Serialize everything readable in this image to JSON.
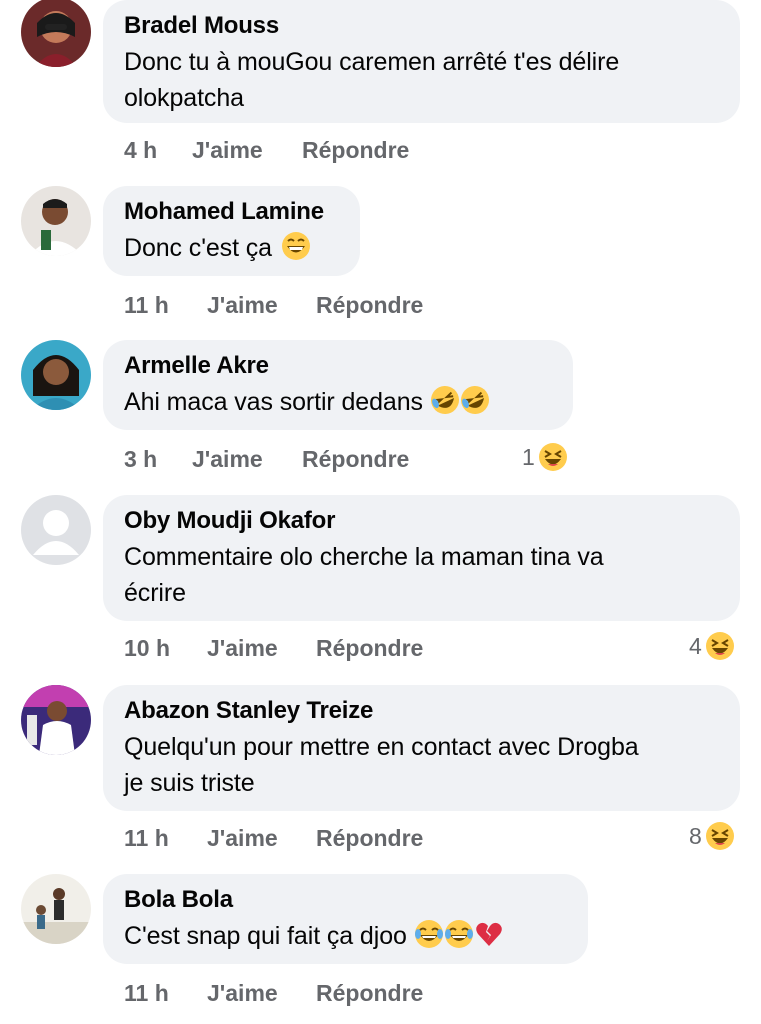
{
  "comments": [
    {
      "author": "Bradel Mouss",
      "lines": [
        "Donc tu  à mouGou  caremen arrêté t'es délire",
        "olokpatcha"
      ],
      "time": "4 h",
      "like_label": "J'aime",
      "reply_label": "Répondre",
      "emojis": [],
      "reaction": null
    },
    {
      "author": "Mohamed Lamine",
      "lines": [
        "Donc c'est ça"
      ],
      "time": "11 h",
      "like_label": "J'aime",
      "reply_label": "Répondre",
      "emojis": [
        "grinning-sweat-emoji"
      ],
      "reaction": null
    },
    {
      "author": "Armelle Akre",
      "lines": [
        "Ahi maca vas sortir dedans"
      ],
      "time": "3 h",
      "like_label": "J'aime",
      "reply_label": "Répondre",
      "emojis": [
        "rolling-laughing-emoji",
        "rolling-laughing-emoji"
      ],
      "reaction": {
        "count": "1",
        "icon": "haha-reaction-icon"
      }
    },
    {
      "author": "Oby Moudji Okafor",
      "lines": [
        "Commentaire olo cherche la maman tina va",
        "écrire"
      ],
      "time": "10 h",
      "like_label": "J'aime",
      "reply_label": "Répondre",
      "emojis": [],
      "reaction": {
        "count": "4",
        "icon": "haha-reaction-icon"
      }
    },
    {
      "author": "Abazon Stanley Treize",
      "lines": [
        "Quelqu'un pour mettre en contact avec Drogba",
        "je suis triste"
      ],
      "time": "11 h",
      "like_label": "J'aime",
      "reply_label": "Répondre",
      "emojis": [],
      "reaction": {
        "count": "8",
        "icon": "haha-reaction-icon"
      }
    },
    {
      "author": "Bola Bola",
      "lines": [
        "C'est snap qui fait ça djoo"
      ],
      "time": "11 h",
      "like_label": "J'aime",
      "reply_label": "Répondre",
      "emojis": [
        "tears-of-joy-emoji",
        "tears-of-joy-emoji",
        "broken-heart-emoji"
      ],
      "reaction": null
    }
  ],
  "colors": {
    "bubble": "#f0f2f5",
    "meta_text": "#65676b",
    "text": "#050505",
    "emoji_yellow": "#ffcc4d",
    "heart_red": "#dd2e44"
  }
}
